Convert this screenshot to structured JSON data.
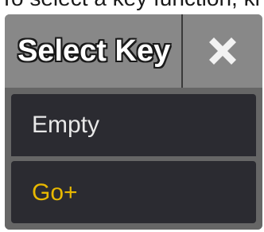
{
  "caption": "To select a key function, ki",
  "dialog": {
    "title": "Select Key",
    "close_icon": "close-x-icon"
  },
  "items": [
    {
      "label": "Empty",
      "color": "#e8e8e8"
    },
    {
      "label": "Go+",
      "color": "#e8b800"
    }
  ],
  "colors": {
    "header_bg": "#888888",
    "item_bg": "#2b2b31",
    "selected_text": "#e8b800"
  }
}
